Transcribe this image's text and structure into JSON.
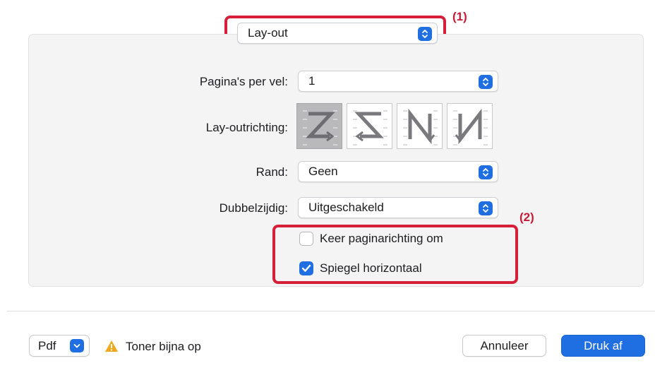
{
  "top_popup": {
    "value": "Lay-out"
  },
  "fields": {
    "pages_per_sheet": {
      "label": "Pagina's per vel:",
      "value": "1"
    },
    "layout_direction": {
      "label": "Lay-outrichting:",
      "selected_index": 0,
      "icons": [
        "z-order-icon",
        "reverse-z-order-icon",
        "reverse-n-order-icon",
        "n-order-icon"
      ]
    },
    "border": {
      "label": "Rand:",
      "value": "Geen"
    },
    "two_sided": {
      "label": "Dubbelzijdig:",
      "value": "Uitgeschakeld"
    }
  },
  "checkboxes": {
    "reverse_orientation": {
      "label": "Keer paginarichting om",
      "checked": false
    },
    "flip_horizontal": {
      "label": "Spiegel horizontaal",
      "checked": true
    }
  },
  "annotations": {
    "first": "(1)",
    "second": "(2)",
    "color": "#d6203a"
  },
  "footer": {
    "pdf_label": "Pdf",
    "warning_text": "Toner bijna op",
    "cancel_label": "Annuleer",
    "print_label": "Druk af"
  },
  "colors": {
    "accent": "#1f6fe3",
    "warning": "#f2a81d"
  }
}
